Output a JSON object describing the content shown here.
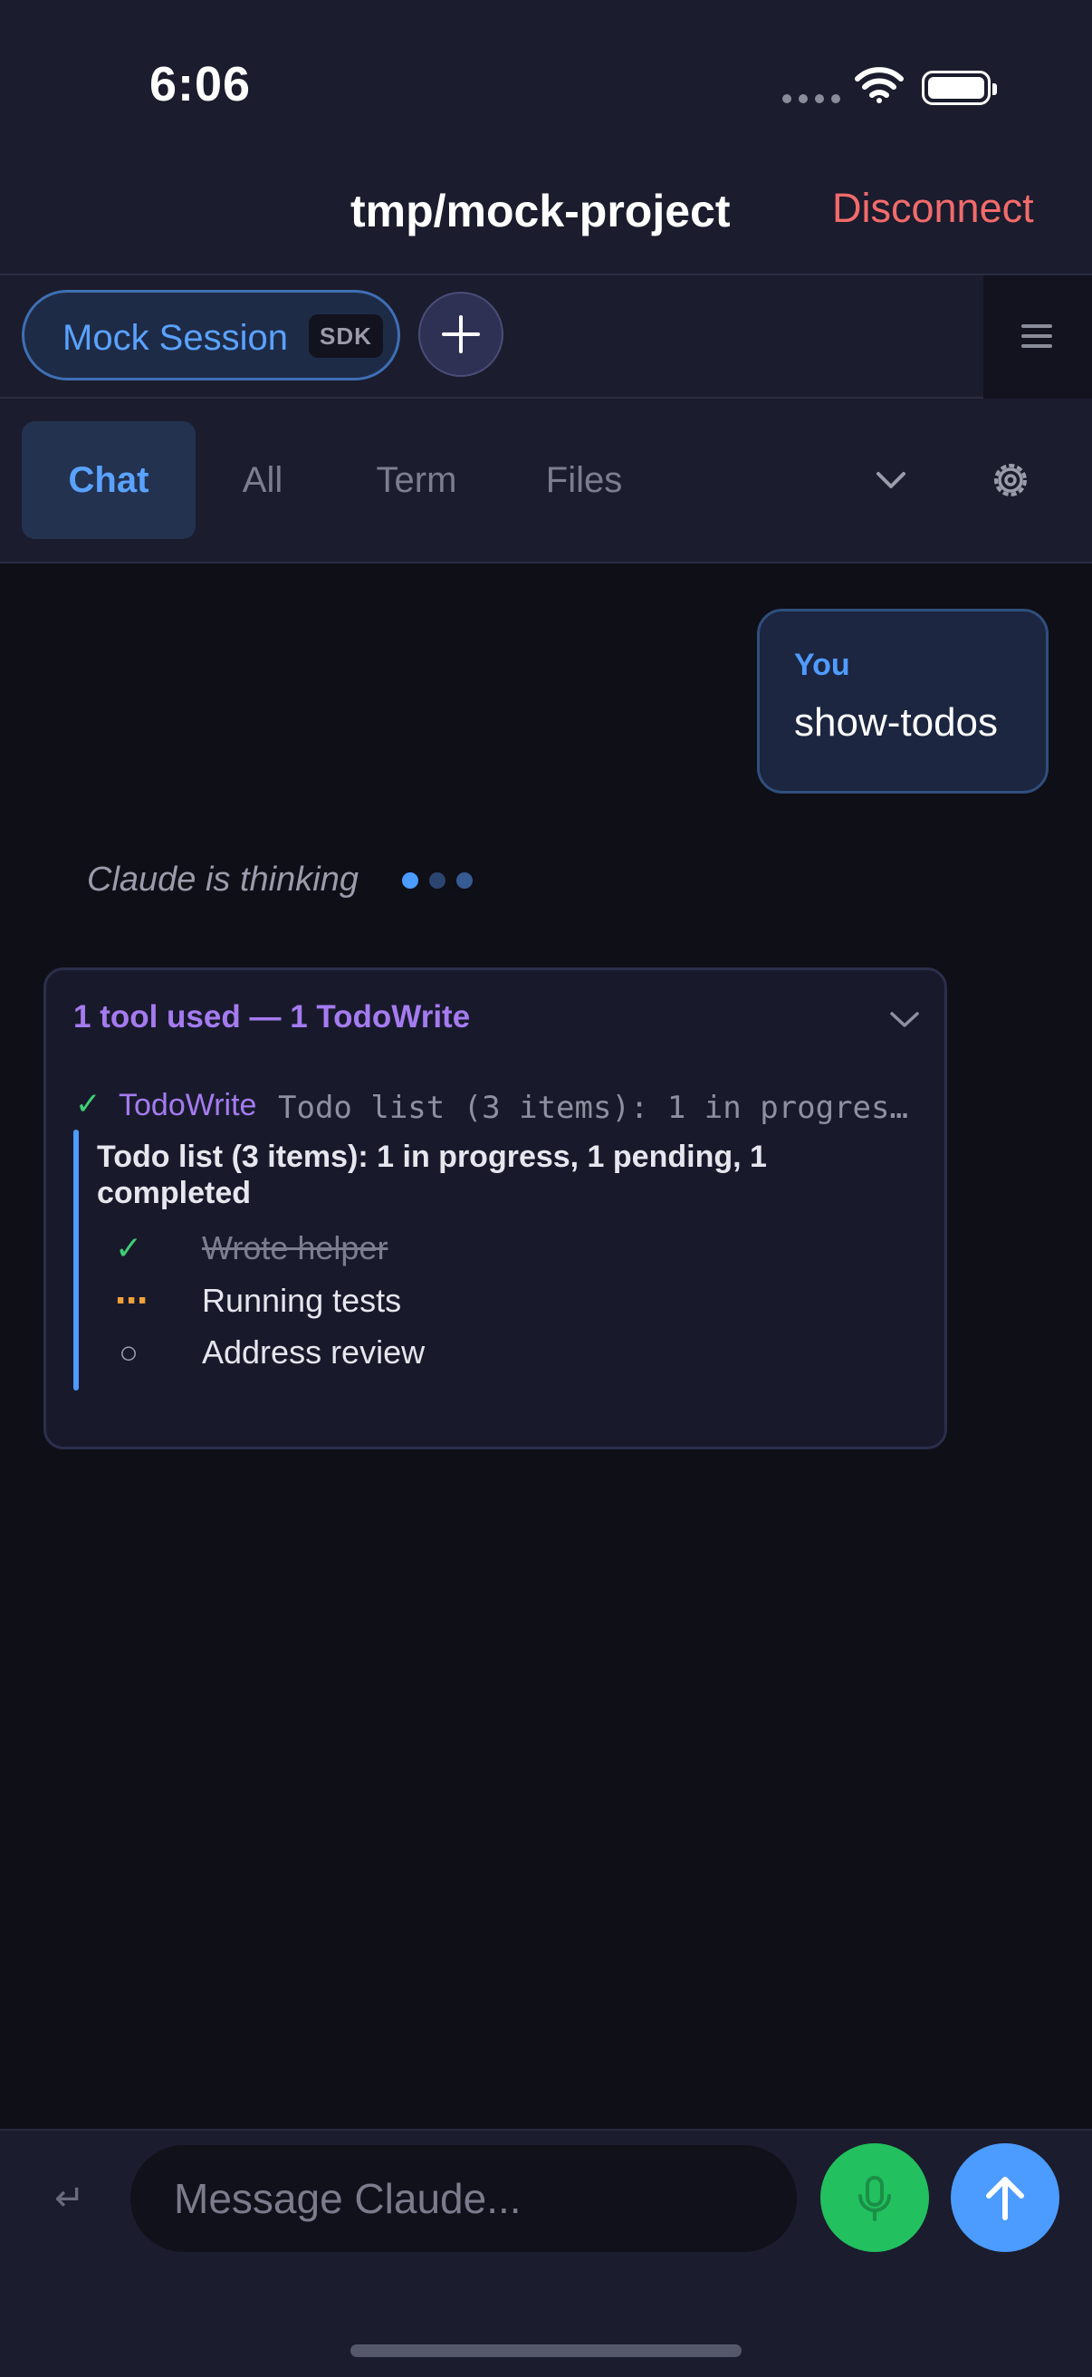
{
  "status_bar": {
    "time": "6:06"
  },
  "header": {
    "project_title": "tmp/mock-project",
    "disconnect_label": "Disconnect"
  },
  "session": {
    "name": "Mock Session",
    "badge": "SDK"
  },
  "tabs": [
    {
      "label": "Chat",
      "active": true
    },
    {
      "label": "All",
      "active": false
    },
    {
      "label": "Term",
      "active": false
    },
    {
      "label": "Files",
      "active": false
    }
  ],
  "messages": {
    "user": {
      "label": "You",
      "text": "show-todos"
    },
    "thinking_text": "Claude is thinking"
  },
  "tool_card": {
    "summary": "1 tool used — 1 TodoWrite",
    "tool_name": "TodoWrite",
    "preview": "Todo list (3 items): 1 in progress…",
    "todo_summary": "Todo list (3 items): 1 in progress, 1 pending, 1 completed",
    "items": [
      {
        "text": "Wrote helper",
        "status": "completed",
        "icon": "✓"
      },
      {
        "text": "Running tests",
        "status": "in_progress",
        "icon": "⋯"
      },
      {
        "text": "Address review",
        "status": "pending",
        "icon": "○"
      }
    ]
  },
  "composer": {
    "placeholder": "Message Claude...",
    "enter_icon": "↵"
  },
  "colors": {
    "accent_blue": "#4c9bff",
    "purple": "#a57bf0",
    "danger": "#f26b6b",
    "success": "#22c05e",
    "warning": "#f0a23a"
  }
}
